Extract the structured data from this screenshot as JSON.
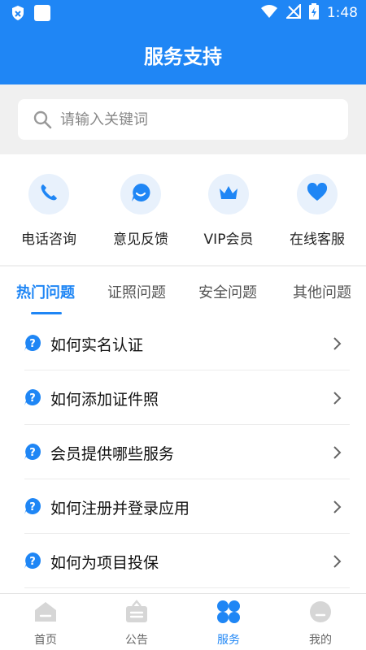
{
  "status_bar": {
    "time": "1:48"
  },
  "header": {
    "title": "服务支持"
  },
  "search": {
    "placeholder": "请输入关键词"
  },
  "quick_actions": [
    {
      "label": "电话咨询",
      "icon": "phone-icon"
    },
    {
      "label": "意见反馈",
      "icon": "chat-smile-icon"
    },
    {
      "label": "VIP会员",
      "icon": "crown-icon"
    },
    {
      "label": "在线客服",
      "icon": "heart-icon"
    }
  ],
  "tabs": [
    {
      "label": "热门问题",
      "active": true
    },
    {
      "label": "证照问题"
    },
    {
      "label": "安全问题"
    },
    {
      "label": "其他问题"
    }
  ],
  "questions": [
    {
      "label": "如何实名认证"
    },
    {
      "label": "如何添加证件照"
    },
    {
      "label": "会员提供哪些服务"
    },
    {
      "label": "如何注册并登录应用"
    },
    {
      "label": "如何为项目投保"
    }
  ],
  "bottom_nav": [
    {
      "label": "首页",
      "icon": "home-icon"
    },
    {
      "label": "公告",
      "icon": "notice-icon"
    },
    {
      "label": "服务",
      "icon": "service-grid-icon",
      "active": true
    },
    {
      "label": "我的",
      "icon": "profile-icon"
    }
  ],
  "colors": {
    "primary": "#1f86f5",
    "icon_bg": "#e8f1fc",
    "inactive": "#d6d6d6"
  }
}
